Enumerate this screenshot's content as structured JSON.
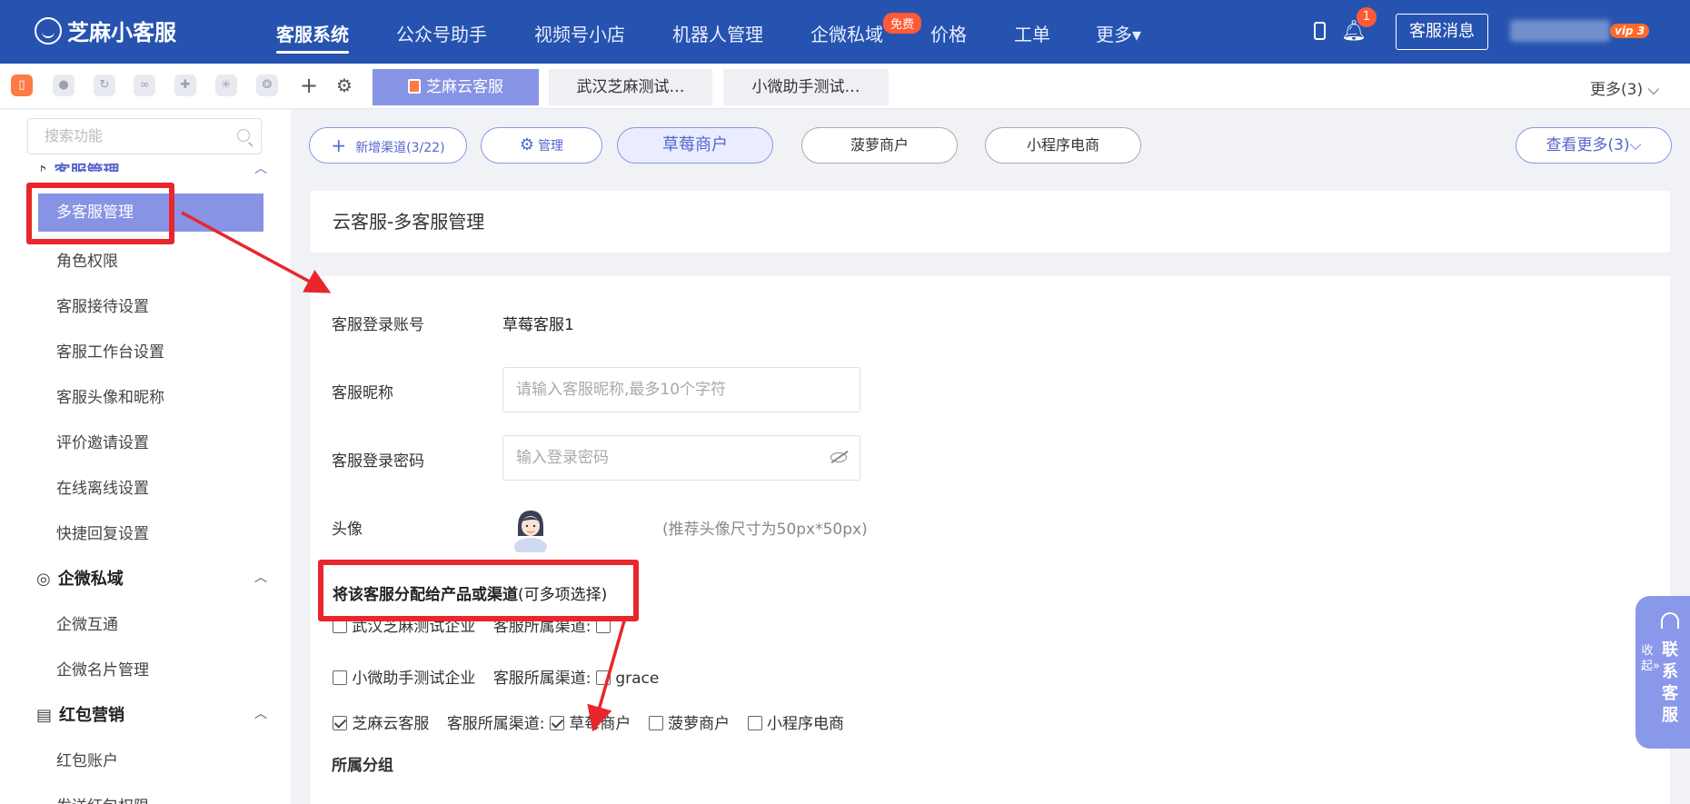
{
  "header": {
    "logo": "芝麻小客服",
    "nav": [
      "客服系统",
      "公众号助手",
      "视频号小店",
      "机器人管理",
      "企微私域",
      "价格",
      "工单",
      "更多▾"
    ],
    "free_badge": "免费",
    "bell_count": "1",
    "message_button": "客服消息",
    "vip_badge": "vip 3"
  },
  "subbar": {
    "icons": [
      "phone-icon",
      "chat-icon",
      "refresh-icon",
      "link-icon",
      "puzzle-icon",
      "asterisk-icon",
      "openai-icon"
    ],
    "tabs": [
      "芝麻云客服",
      "武汉芝麻测试…",
      "小微助手测试…"
    ],
    "more": "更多(3) ⌵"
  },
  "sidebar": {
    "search_placeholder": "搜索功能",
    "group1": "客服管理",
    "group1_items": [
      "多客服管理",
      "角色权限",
      "客服接待设置",
      "客服工作台设置",
      "客服头像和昵称",
      "评价邀请设置",
      "在线离线设置",
      "快捷回复设置"
    ],
    "group2": "企微私域",
    "group2_items": [
      "企微互通",
      "企微名片管理"
    ],
    "group3": "红包营销",
    "group3_items": [
      "红包账户",
      "发送红包权限"
    ]
  },
  "channels": {
    "add": "新增渠道(3/22)",
    "manage": "管理",
    "items": [
      "草莓商户",
      "菠萝商户",
      "小程序电商"
    ],
    "view_more": "查看更多(3)⌵"
  },
  "page_title": "云客服-多客服管理",
  "form": {
    "account_label": "客服登录账号",
    "account_value": "草莓客服1",
    "nickname_label": "客服昵称",
    "nickname_placeholder": "请输入客服昵称,最多10个字符",
    "password_label": "客服登录密码",
    "password_placeholder": "输入登录密码",
    "avatar_label": "头像",
    "avatar_hint": "(推荐头像尺寸为50px*50px)",
    "assign_title": "将该客服分配给产品或渠道",
    "assign_note": "(可多项选择)",
    "channel_label": "客服所属渠道:",
    "rows": [
      {
        "name": "武汉芝麻测试企业",
        "checked": false,
        "channels": [
          {
            "name": "",
            "checked": false
          }
        ]
      },
      {
        "name": "小微助手测试企业",
        "checked": false,
        "channels": [
          {
            "name": "grace",
            "checked": false
          }
        ]
      },
      {
        "name": "芝麻云客服",
        "checked": true,
        "channels": [
          {
            "name": "草莓商户",
            "checked": true
          },
          {
            "name": "菠萝商户",
            "checked": false
          },
          {
            "name": "小程序电商",
            "checked": false
          }
        ]
      }
    ],
    "group_label": "所属分组"
  },
  "float": {
    "collapse": "收起»",
    "contact": "联系客服"
  }
}
